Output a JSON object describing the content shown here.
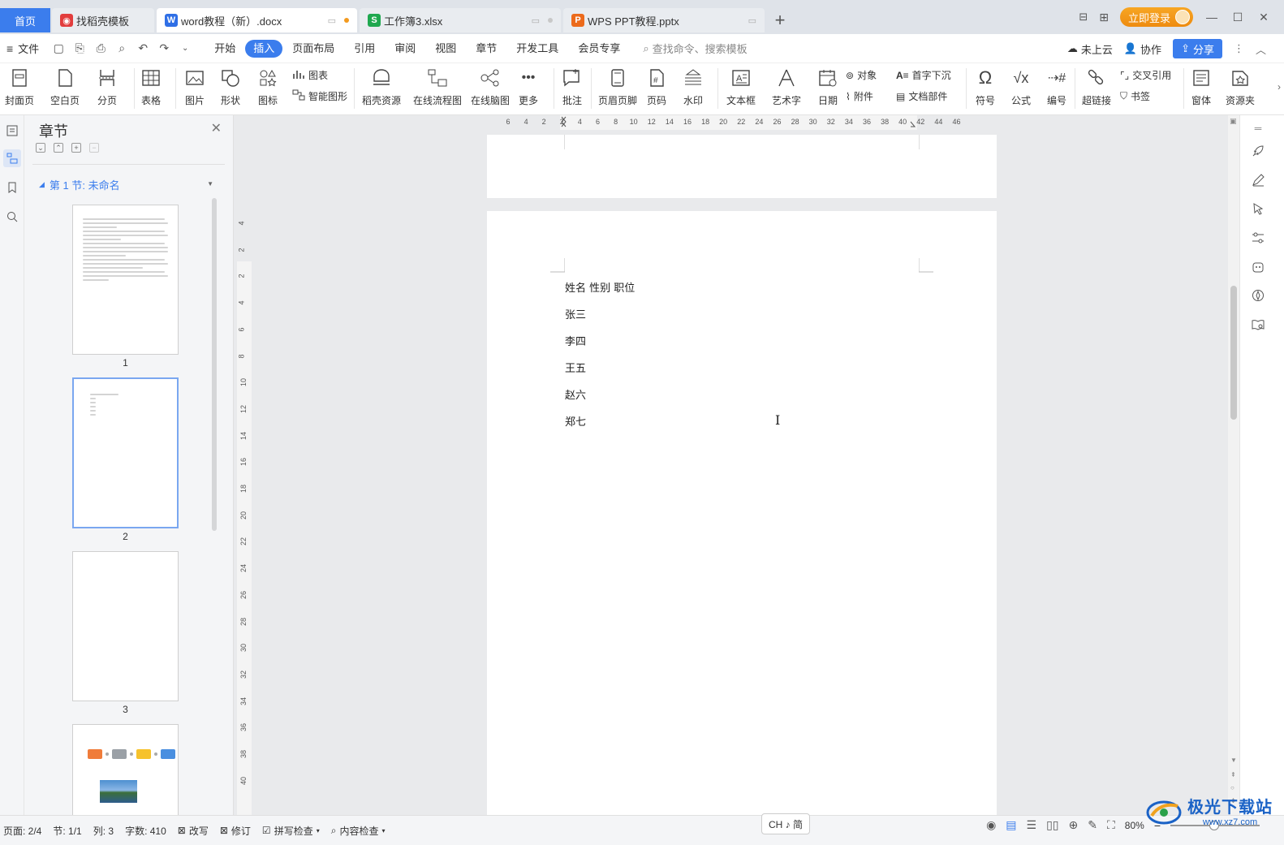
{
  "tabs": {
    "home": "首页",
    "t1": "找稻壳模板",
    "t2": "word教程（新）.docx",
    "t3": "工作簿3.xlsx",
    "t4": "WPS PPT教程.pptx",
    "login": "立即登录"
  },
  "menu": {
    "file": "文件",
    "items": [
      "开始",
      "插入",
      "页面布局",
      "引用",
      "审阅",
      "视图",
      "章节",
      "开发工具",
      "会员专享"
    ],
    "search": "查找命令、搜索模板",
    "cloud": "未上云",
    "collab": "协作",
    "share": "分享"
  },
  "ribbon": {
    "cover": "封面页",
    "blank": "空白页",
    "pagebreak": "分页",
    "table": "表格",
    "picture": "图片",
    "shape": "形状",
    "icon": "图标",
    "chart": "图表",
    "smartart": "智能图形",
    "docer": "稻壳资源",
    "flow": "在线流程图",
    "mind": "在线脑图",
    "more": "更多",
    "comment": "批注",
    "header": "页眉页脚",
    "pagenum": "页码",
    "watermark": "水印",
    "textbox": "文本框",
    "wordart": "艺术字",
    "date": "日期",
    "object": "对象",
    "attach": "附件",
    "dropcap": "首字下沉",
    "docpart": "文档部件",
    "symbol": "符号",
    "formula": "公式",
    "numbering": "编号",
    "hyperlink": "超链接",
    "crossref": "交叉引用",
    "bookmark": "书签",
    "window": "窗体",
    "resource": "资源夹"
  },
  "chapter": {
    "title": "章节",
    "section": "第 1 节: 未命名",
    "pages": [
      "1",
      "2",
      "3"
    ]
  },
  "ruler": {
    "h": [
      "6",
      "4",
      "2",
      "2",
      "4",
      "6",
      "8",
      "10",
      "12",
      "14",
      "16",
      "18",
      "20",
      "22",
      "24",
      "26",
      "28",
      "30",
      "32",
      "34",
      "36",
      "38",
      "40",
      "42",
      "44",
      "46"
    ],
    "v": [
      "4",
      "2",
      "2",
      "4",
      "6",
      "8",
      "10",
      "12",
      "14",
      "16",
      "18",
      "20",
      "22",
      "24",
      "26",
      "28",
      "30",
      "32",
      "34",
      "36",
      "38",
      "40"
    ]
  },
  "doc": {
    "lines": [
      "姓名  性别   职位",
      "张三",
      "李四",
      "王五",
      "赵六",
      "郑七"
    ]
  },
  "status": {
    "page": "页面: 2/4",
    "section": "节: 1/1",
    "col": "列: 3",
    "words": "字数: 410",
    "overwrite": "改写",
    "revise": "修订",
    "spell": "拼写检查",
    "content": "内容检查",
    "ime": "CH ♪ 简",
    "zoom": "80%"
  },
  "watermark": {
    "cn": "极光下载站",
    "url": "www.xz7.com"
  },
  "colors": {
    "accent": "#3b7ded",
    "login": "#f39a1e",
    "watermark": "#1a62c6"
  }
}
